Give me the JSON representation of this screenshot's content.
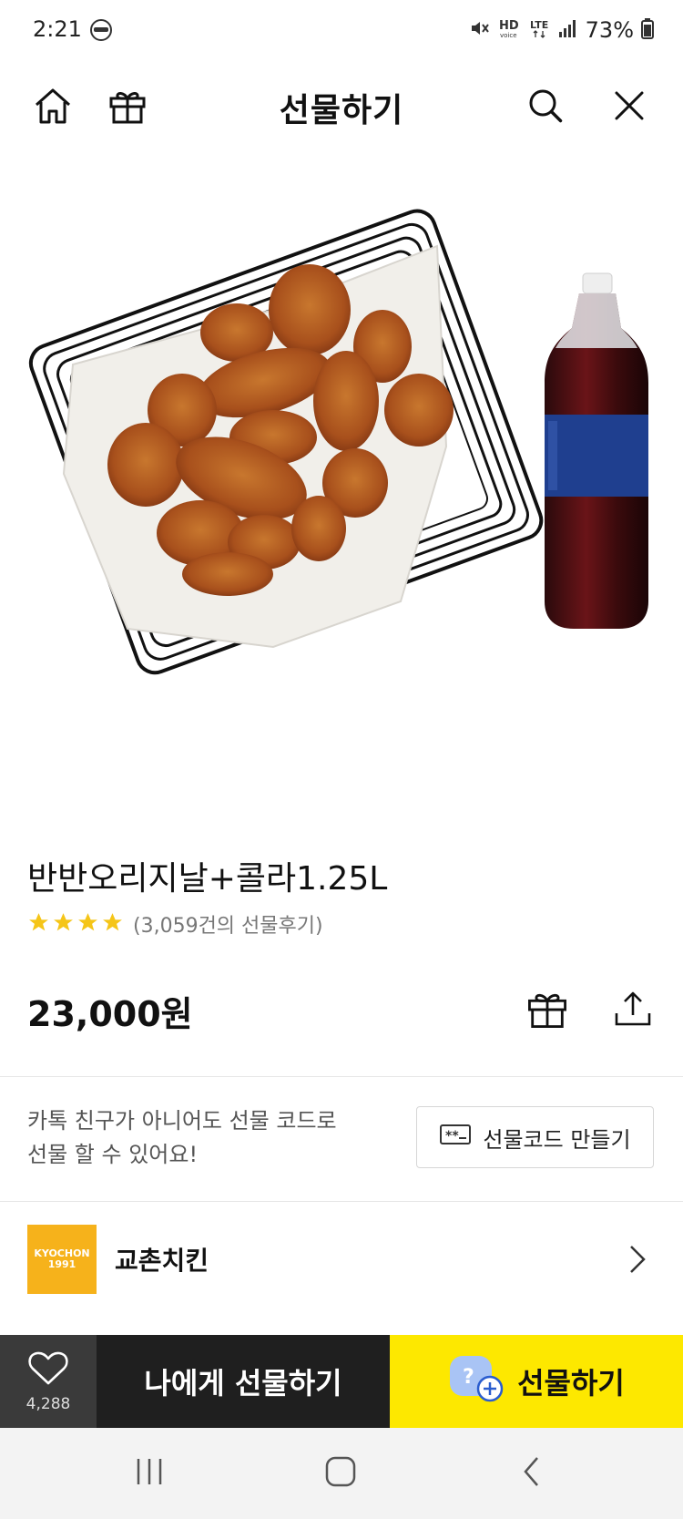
{
  "status_bar": {
    "time": "2:21",
    "battery": "73%",
    "indicators": [
      "mute-icon",
      "hd-voice-icon",
      "lte-icon",
      "signal-icon",
      "battery-icon"
    ]
  },
  "header": {
    "title": "선물하기",
    "left_icons": [
      "home-icon",
      "gift-box-icon"
    ],
    "right_icons": [
      "search-icon",
      "close-icon"
    ]
  },
  "product": {
    "name": "반반오리지날+콜라1.25L",
    "rating_stars": 4,
    "review_text": "(3,059건의 선물후기)",
    "price": "23,000원"
  },
  "gift_code": {
    "desc_line1": "카톡 친구가 아니어도 선물 코드로",
    "desc_line2": "선물 할 수 있어요!",
    "button_label": "선물코드 만들기"
  },
  "brand": {
    "name": "교촌치킨",
    "logo_line1": "KYOCHON",
    "logo_line2": "1991"
  },
  "bottom_bar": {
    "like_count": "4,288",
    "self_gift_label": "나에게 선물하기",
    "gift_label": "선물하기"
  },
  "colors": {
    "accent_yellow": "#fde800",
    "dark_button": "#1f1f1f",
    "like_bg": "#3a3a3a",
    "brand_orange": "#f6b21b",
    "star": "#f5c518"
  }
}
